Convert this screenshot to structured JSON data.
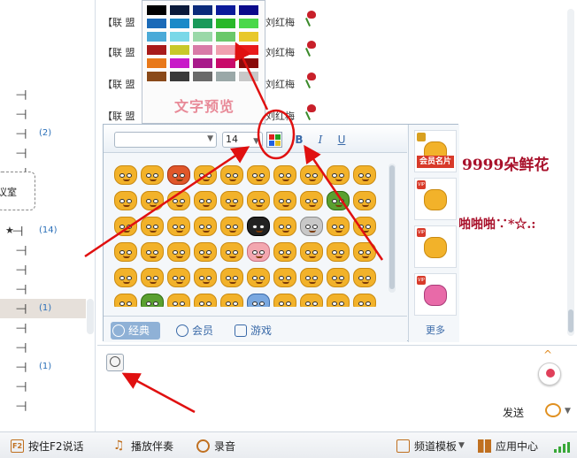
{
  "tree": {
    "rows": [
      {
        "dash": "—|",
        "count": ""
      },
      {
        "dash": "—|",
        "count": ""
      },
      {
        "dash": "—|",
        "count": "(2)"
      },
      {
        "dash": "—|",
        "count": ""
      },
      {
        "dash": "—|",
        "count": ""
      },
      {
        "dash": "★—|",
        "count": "(14)"
      },
      {
        "dash": "—|",
        "count": ""
      },
      {
        "dash": "—|",
        "count": ""
      },
      {
        "dash": "—|",
        "count": ""
      },
      {
        "dash": "—|",
        "count": "(1)"
      },
      {
        "dash": "—|",
        "count": ""
      },
      {
        "dash": "—|",
        "count": ""
      },
      {
        "dash": "—|",
        "count": "(1)"
      },
      {
        "dash": "—|",
        "count": ""
      },
      {
        "dash": "—|",
        "count": ""
      }
    ],
    "room_label": "议室"
  },
  "messages": [
    {
      "prefix": "【联 盟",
      "name": "刘红梅"
    },
    {
      "prefix": "【联 盟",
      "name": "刘红梅"
    },
    {
      "prefix": "【联 盟",
      "name": "刘红梅"
    },
    {
      "prefix": "【联 盟",
      "name": "刘红梅"
    }
  ],
  "big_text_1": "9999朵鲜花",
  "big_text_2": "啪啪啪∵*☆.:",
  "palette": {
    "colors": [
      [
        "#000000",
        "#0a1a3a",
        "#0a2a7a",
        "#0a1a9a",
        "#0a0a8a"
      ],
      [
        "#1a6ab8",
        "#1a8ac8",
        "#1a9a5a",
        "#2ab82a",
        "#4ad84a"
      ],
      [
        "#4aaad8",
        "#7ad8e8",
        "#9ad8a8",
        "#6ac86a",
        "#e8c82a"
      ],
      [
        "#a81a1a",
        "#c8c82a",
        "#d87aa8",
        "#f0a0b0",
        "#e81a1a"
      ],
      [
        "#e8781a",
        "#c81ac8",
        "#a81a8a",
        "#c80a6a",
        "#8a0a0a"
      ],
      [
        "#8a4a1a",
        "#3a3a3a",
        "#6a6a6a",
        "#9aa8a8",
        "#c8c8c8"
      ]
    ],
    "preview_label": "文字预览"
  },
  "format_bar": {
    "font_value": "",
    "size_value": "14",
    "bold": "B",
    "italic": "I",
    "underline": "U"
  },
  "emoji_tabs": {
    "classic": "经典",
    "member": "会员",
    "game": "游戏"
  },
  "vip": {
    "card_label": "会员名片",
    "vip_tag": "VIP",
    "more": "更多"
  },
  "input": {
    "send": "发送"
  },
  "bottom_bar": {
    "f2_talk": "按住F2说话",
    "f2_icon": "F2",
    "music": "播放伴奏",
    "record": "录音",
    "template": "频道模板",
    "app_center": "应用中心"
  },
  "accent": {
    "rose": "#c8202a",
    "link": "#2a6fb8",
    "arrow": "#e01010"
  }
}
